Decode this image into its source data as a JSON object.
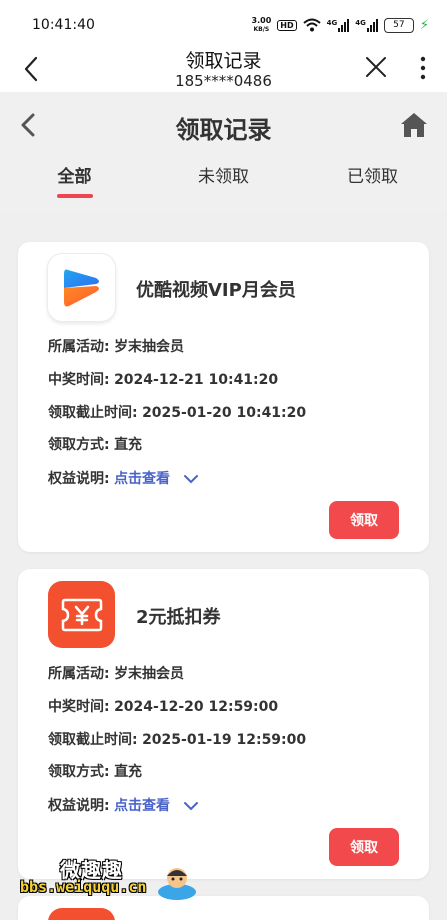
{
  "status_bar": {
    "time": "10:41:40",
    "net_speed_value": "3.00",
    "net_speed_unit": "KB/S",
    "hd": "HD",
    "signal1": "4G",
    "signal2": "4G",
    "battery": "57"
  },
  "title_bar": {
    "title": "领取记录",
    "subtitle": "185****0486"
  },
  "page_header": {
    "title": "领取记录",
    "tabs": [
      {
        "label": "全部",
        "active": true
      },
      {
        "label": "未领取",
        "active": false
      },
      {
        "label": "已领取",
        "active": false
      }
    ]
  },
  "records": [
    {
      "name": "优酷视频VIP月会员",
      "icon": "youku-play-icon",
      "activity_key": "所属活动:",
      "activity": "岁末抽会员",
      "win_time_key": "中奖时间:",
      "win_time": "2024-12-21 10:41:20",
      "deadline_key": "领取截止时间:",
      "deadline": "2025-01-20 10:41:20",
      "method_key": "领取方式:",
      "method": "直充",
      "rights_key": "权益说明:",
      "rights_link": "点击查看",
      "button": "领取"
    },
    {
      "name": "2元抵扣券",
      "icon": "voucher-ticket-icon",
      "activity_key": "所属活动:",
      "activity": "岁末抽会员",
      "win_time_key": "中奖时间:",
      "win_time": "2024-12-20 12:59:00",
      "deadline_key": "领取截止时间:",
      "deadline": "2025-01-19 12:59:00",
      "method_key": "领取方式:",
      "method": "直充",
      "rights_key": "权益说明:",
      "rights_link": "点击查看",
      "button": "领取"
    }
  ],
  "watermark": {
    "site_name": "微趣趣",
    "url": "bbs.weiququ.cn"
  },
  "colors": {
    "accent_red": "#f24a4c",
    "link_blue": "#4a63c9",
    "voucher_orange": "#f2502e"
  }
}
